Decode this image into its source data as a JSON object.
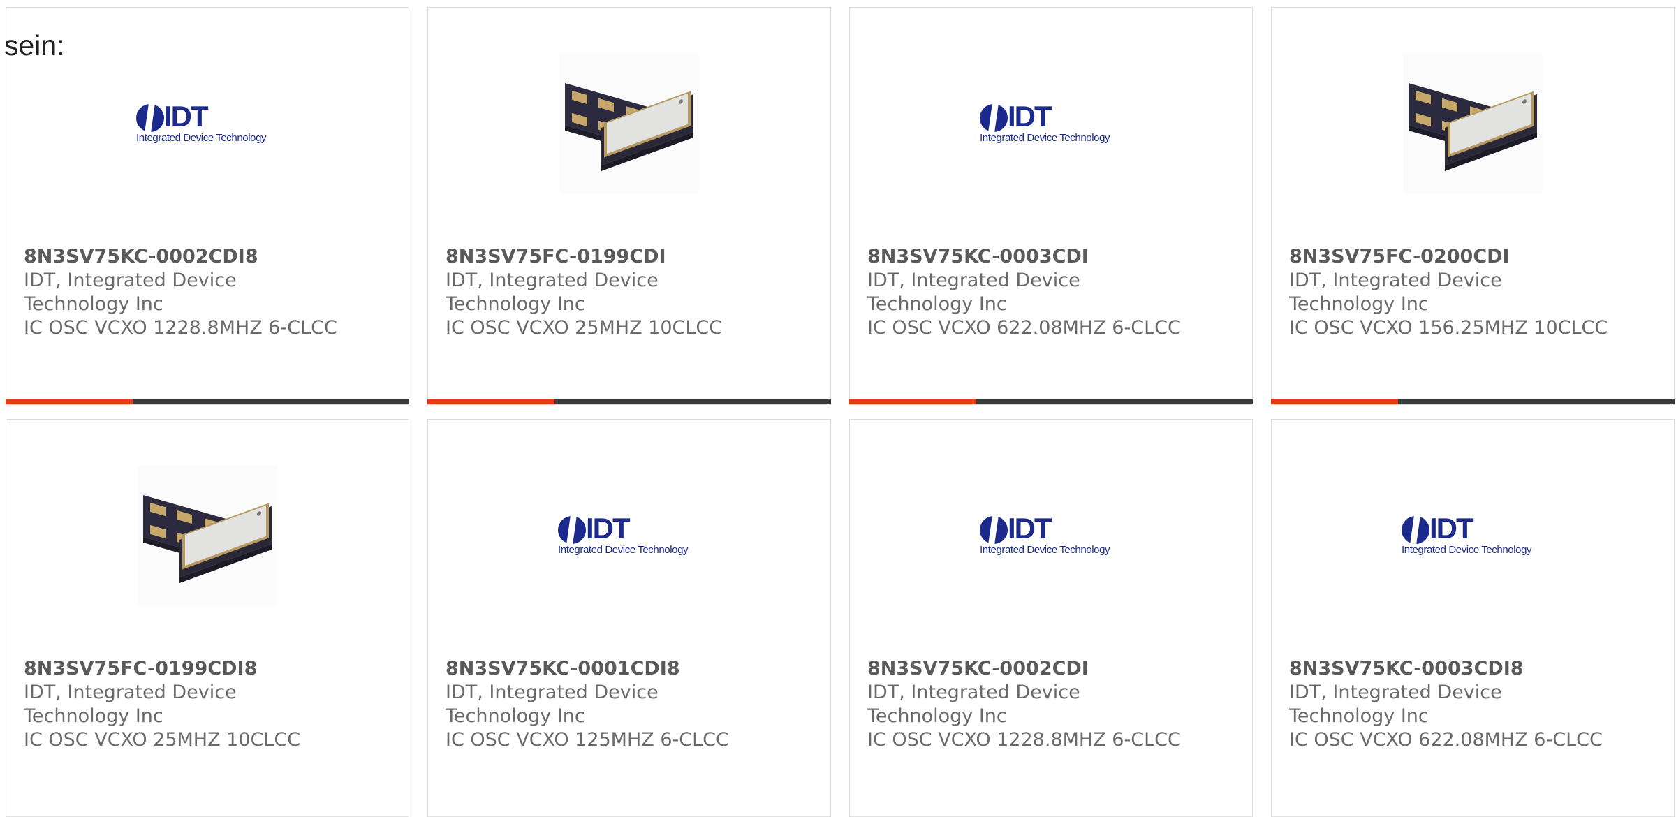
{
  "intro_text": "sein:",
  "colors": {
    "accent": "#e63a12",
    "bar": "#3a3a3a",
    "logo_blue": "#1b2a8c"
  },
  "products": [
    {
      "part_number": "8N3SV75KC-0002CDI8",
      "manufacturer": "IDT, Integrated Device Technology Inc",
      "description": "IC OSC VCXO 1228.8MHZ 6-CLCC",
      "image": "idt-logo"
    },
    {
      "part_number": "8N3SV75FC-0199CDI",
      "manufacturer": "IDT, Integrated Device Technology Inc",
      "description": "IC OSC VCXO 25MHZ 10CLCC",
      "image": "oscillator-photo"
    },
    {
      "part_number": "8N3SV75KC-0003CDI",
      "manufacturer": "IDT, Integrated Device Technology Inc",
      "description": "IC OSC VCXO 622.08MHZ 6-CLCC",
      "image": "idt-logo"
    },
    {
      "part_number": "8N3SV75FC-0200CDI",
      "manufacturer": "IDT, Integrated Device Technology Inc",
      "description": "IC OSC VCXO 156.25MHZ 10CLCC",
      "image": "oscillator-photo"
    },
    {
      "part_number": "8N3SV75FC-0199CDI8",
      "manufacturer": "IDT, Integrated Device Technology Inc",
      "description": "IC OSC VCXO 25MHZ 10CLCC",
      "image": "oscillator-photo"
    },
    {
      "part_number": "8N3SV75KC-0001CDI8",
      "manufacturer": "IDT, Integrated Device Technology Inc",
      "description": "IC OSC VCXO 125MHZ 6-CLCC",
      "image": "idt-logo"
    },
    {
      "part_number": "8N3SV75KC-0002CDI",
      "manufacturer": "IDT, Integrated Device Technology Inc",
      "description": "IC OSC VCXO 1228.8MHZ 6-CLCC",
      "image": "idt-logo"
    },
    {
      "part_number": "8N3SV75KC-0003CDI8",
      "manufacturer": "IDT, Integrated Device Technology Inc",
      "description": "IC OSC VCXO 622.08MHZ 6-CLCC",
      "image": "idt-logo"
    }
  ],
  "logo": {
    "word": "IDT",
    "tagline": "Integrated Device Technology"
  }
}
